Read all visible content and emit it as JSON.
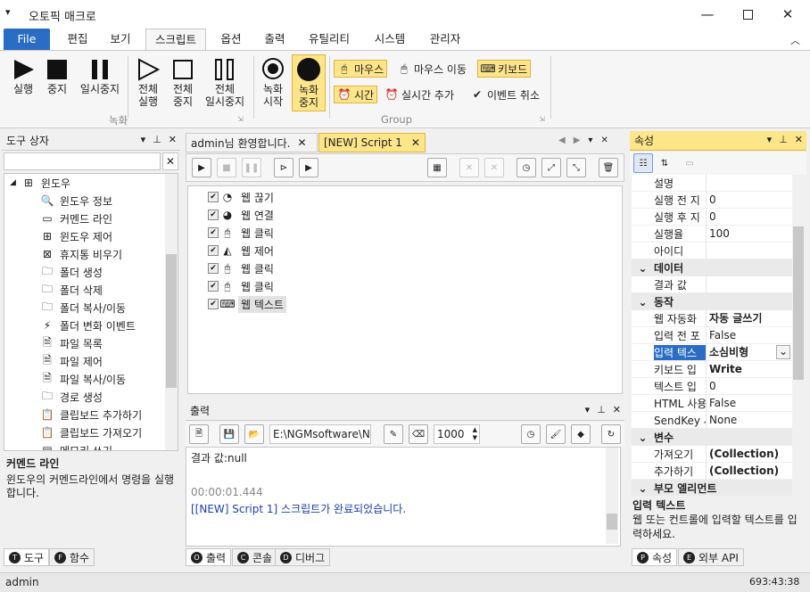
{
  "window": {
    "title": "오토픽 매크로",
    "qa_icon": "▾"
  },
  "ribbon_tabs": [
    "File",
    "편집",
    "보기",
    "스크립트",
    "옵션",
    "출력",
    "유틸리티",
    "시스템",
    "관리자"
  ],
  "ribbon": {
    "record": {
      "buttons": [
        [
          "실행",
          ""
        ],
        [
          "중지",
          ""
        ],
        [
          "일시중지",
          ""
        ],
        [
          "전체",
          "실행"
        ],
        [
          "전체",
          "중지"
        ],
        [
          "전체",
          "일시중지"
        ]
      ],
      "group": "녹화"
    },
    "rec": {
      "buttons": [
        [
          "녹화",
          "시작"
        ],
        [
          "녹화",
          "중지"
        ]
      ]
    },
    "group2": {
      "mouse": "마우스",
      "mouse_move": "마우스 이동",
      "keyboard": "키보드",
      "time": "시간",
      "realtime": "실시간 추가",
      "cancel_event": "이벤트 취소",
      "group": "Group"
    }
  },
  "toolbox": {
    "title": "도구 상자",
    "root": "윈도우",
    "items": [
      "윈도우 정보",
      "커멘드 라인",
      "윈도우 제어",
      "휴지통 비우기",
      "폴더 생성",
      "폴더 삭제",
      "폴더 복사/이동",
      "폴더 변화 이벤트",
      "파일 목록",
      "파일 제어",
      "파일 복사/이동",
      "경로 생성",
      "클립보드 추가하기",
      "클립보드 가져오기",
      "메모리 쓰기"
    ],
    "desc_title": "커멘드 라인",
    "desc_text": "윈도우의 커멘드라인에서 명령을 실행합니다.",
    "tabs": [
      "도구",
      "함수"
    ],
    "tab_letters": [
      "T",
      "F"
    ]
  },
  "doc_tabs": [
    "admin님 환영합니다.",
    "[NEW] Script 1"
  ],
  "script_steps": [
    "웹 끊기",
    "웹 연결",
    "웹 클릭",
    "웹 제어",
    "웹 클릭",
    "웹 클릭",
    "웹 텍스트"
  ],
  "output": {
    "title": "출력",
    "path": "E:\\NGMsoftware\\NG",
    "interval": "1000",
    "lines": [
      "결과 값:null",
      "",
      "00:00:01.444",
      "[[NEW] Script 1] 스크립트가 완료되었습니다."
    ],
    "tabs": [
      "출력",
      "콘솔",
      "디버그"
    ],
    "tab_letters": [
      "O",
      "C",
      "D"
    ]
  },
  "properties": {
    "title": "속성",
    "rows": [
      {
        "k": "설명",
        "v": ""
      },
      {
        "k": "실행 전 지",
        "v": "0"
      },
      {
        "k": "실행 후 지",
        "v": "0"
      },
      {
        "k": "실행율",
        "v": "100"
      },
      {
        "k": "아이디",
        "v": ""
      },
      {
        "cat": "데이터"
      },
      {
        "k": "결과 값",
        "v": ""
      },
      {
        "cat": "동작"
      },
      {
        "k": "웹 자동화",
        "v": "자동 글쓰기",
        "bold": true
      },
      {
        "k": "입력 전 포",
        "v": "False"
      },
      {
        "k": "입력 텍스",
        "v": "소심비형",
        "bold": true,
        "sel": true
      },
      {
        "k": "키보드 입",
        "v": "Write",
        "bold": true
      },
      {
        "k": "텍스트 입",
        "v": "0"
      },
      {
        "k": "HTML 사용",
        "v": "False"
      },
      {
        "k": "SendKey 사",
        "v": "None"
      },
      {
        "cat": "변수"
      },
      {
        "k": "가져오기",
        "v": "(Collection)",
        "bold": true
      },
      {
        "k": "추가하기",
        "v": "(Collection)",
        "bold": true
      },
      {
        "cat": "부모 엘리먼트"
      }
    ],
    "desc_title": "입력 텍스트",
    "desc_text": "웹 또는 컨트롤에 입력할 텍스트를 입력하세요.",
    "tabs": [
      "속성",
      "외부 API"
    ],
    "tab_letters": [
      "P",
      "E"
    ]
  },
  "status": {
    "user": "admin",
    "time": "693:43:38"
  }
}
